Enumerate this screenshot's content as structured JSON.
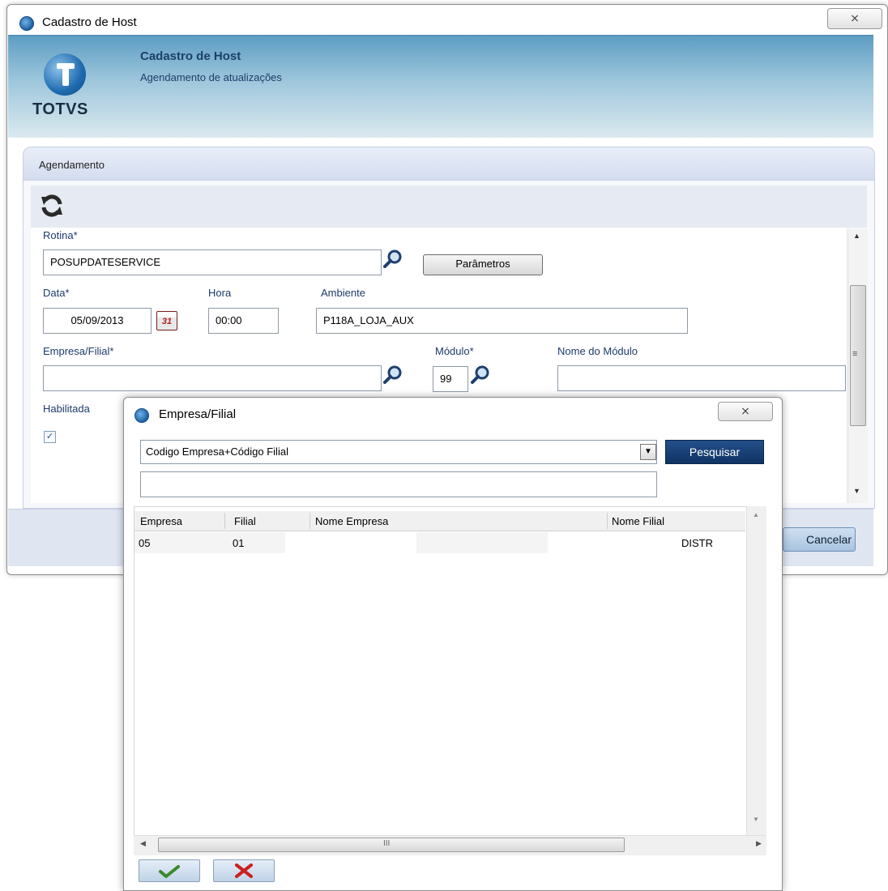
{
  "window": {
    "title": "Cadastro de Host",
    "close_glyph": "⨯"
  },
  "header": {
    "logo_text": "TOTVS",
    "title": "Cadastro de Host",
    "subtitle": "Agendamento de atualizações"
  },
  "section": {
    "label": "Agendamento"
  },
  "form": {
    "rotina_label": "Rotina*",
    "rotina_value": "POSUPDATESERVICE",
    "parametros_label": "Parâmetros",
    "data_label": "Data*",
    "data_value": "05/09/2013",
    "calendar_glyph": "31",
    "hora_label": "Hora",
    "hora_value": "00:00",
    "ambiente_label": "Ambiente",
    "ambiente_value": "P118A_LOJA_AUX",
    "empresa_label": "Empresa/Filial*",
    "empresa_value": "",
    "modulo_label": "Módulo*",
    "modulo_value": "99",
    "nome_modulo_label": "Nome do Módulo",
    "nome_modulo_value": "",
    "habilitada_label": "Habilitada",
    "habilitada_checked": true
  },
  "footer": {
    "cancel_label": "Cancelar"
  },
  "dialog": {
    "title": "Empresa/Filial",
    "close_glyph": "⨯",
    "search_by_value": "Codigo Empresa+Código Filial",
    "search_button": "Pesquisar",
    "search_text": "",
    "columns": [
      "Empresa",
      "Filial",
      "Nome Empresa",
      "Nome Filial"
    ],
    "rows": [
      {
        "empresa": "05",
        "filial": "01",
        "nome_empresa": "",
        "nome_filial": "DISTR"
      }
    ],
    "hscroll_glyph": "III"
  },
  "colors": {
    "header_top": "#5d9dc3",
    "accent_dark_blue": "#0f3464",
    "label_blue": "#1c3b6a"
  }
}
